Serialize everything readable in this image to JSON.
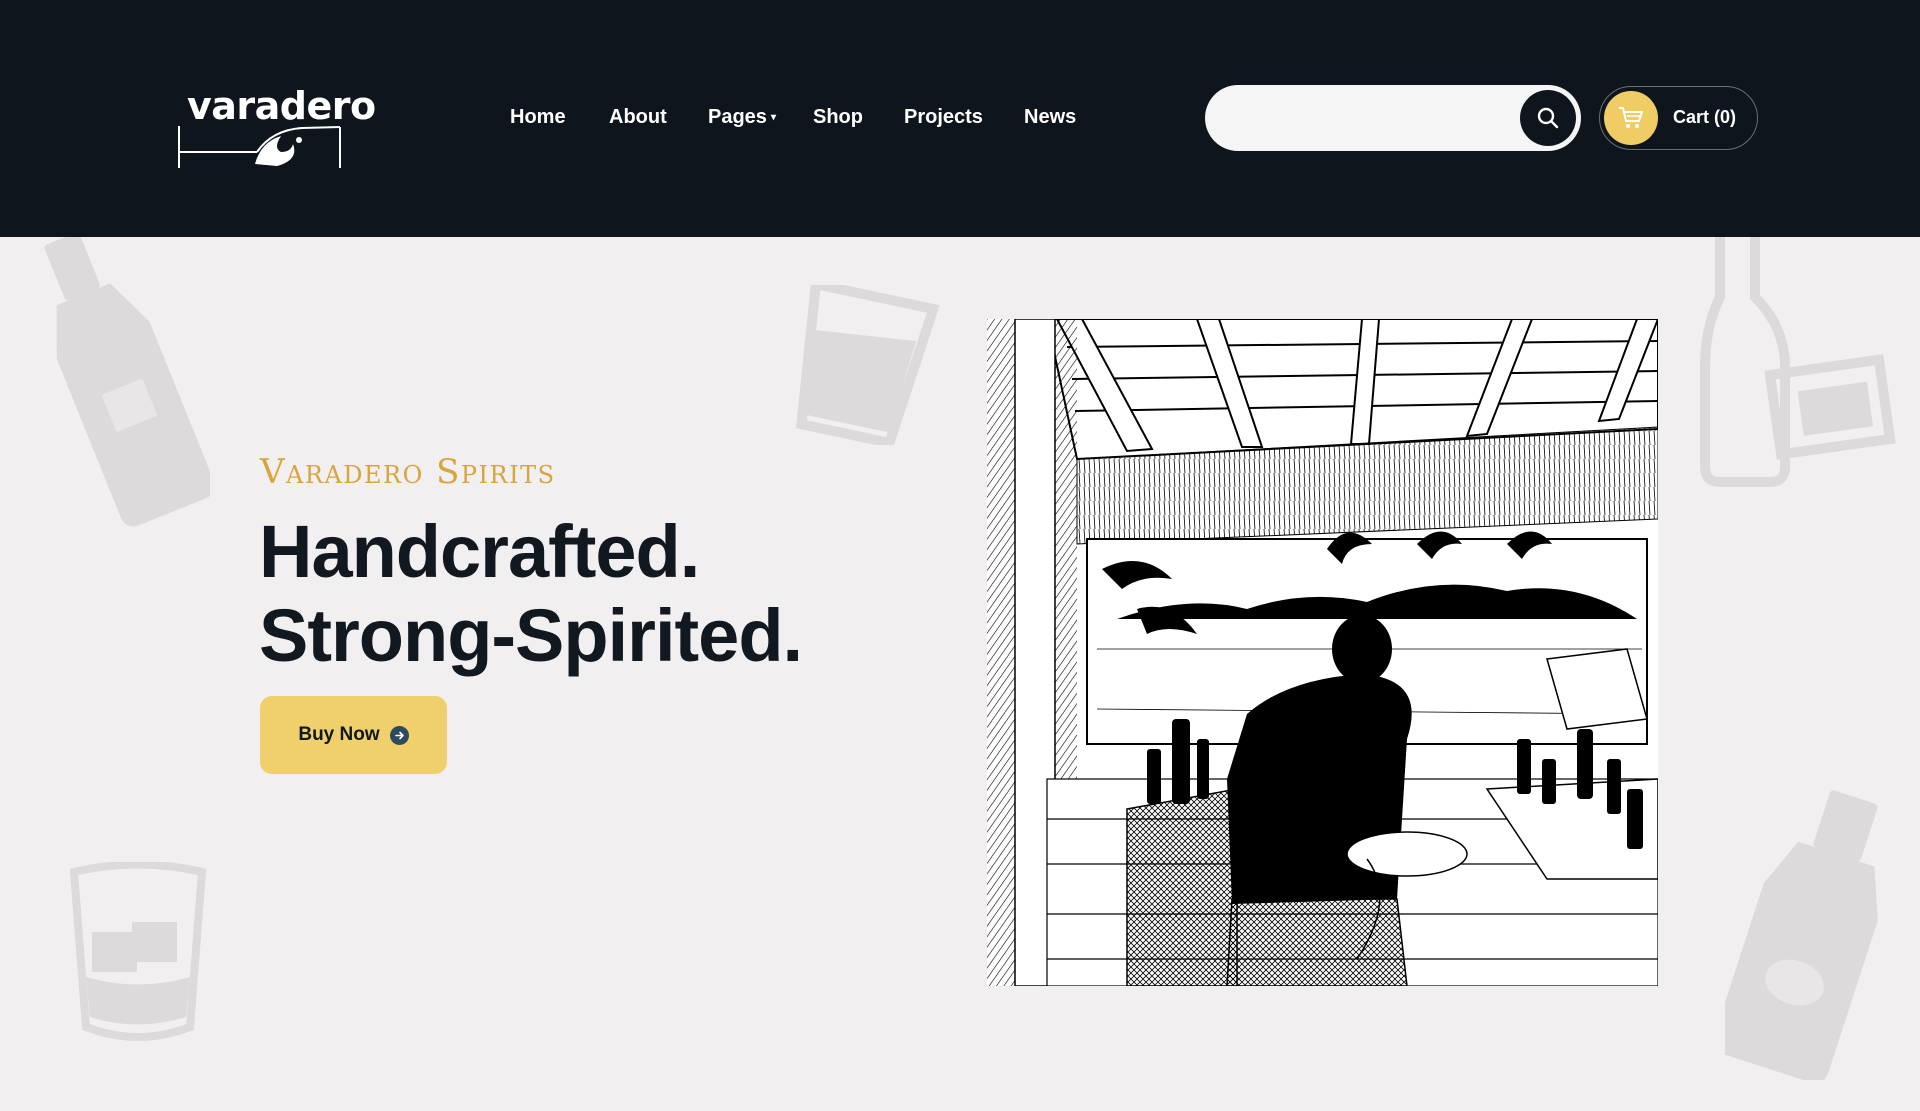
{
  "brand": {
    "name": "varadero",
    "tagline": "Varadero Spirits"
  },
  "nav": {
    "items": [
      {
        "label": "Home"
      },
      {
        "label": "About"
      },
      {
        "label": "Pages",
        "has_dropdown": true
      },
      {
        "label": "Shop"
      },
      {
        "label": "Projects"
      },
      {
        "label": "News"
      }
    ]
  },
  "search": {
    "value": "",
    "placeholder": "",
    "icon": "search-icon"
  },
  "cart": {
    "label": "Cart (0)",
    "icon": "cart-icon"
  },
  "hero": {
    "headline_line1": "Handcrafted.",
    "headline_line2": "Strong-Spirited.",
    "cta_label": "Buy Now",
    "cta_icon": "arrow-right-circle-icon",
    "image": "bartender-beach-bar-illustration"
  },
  "colors": {
    "header_bg": "#0f151d",
    "page_bg": "#f1eff0",
    "accent_gold": "#d8a43b",
    "button_yellow": "#efd06d",
    "text_dark": "#121820"
  }
}
